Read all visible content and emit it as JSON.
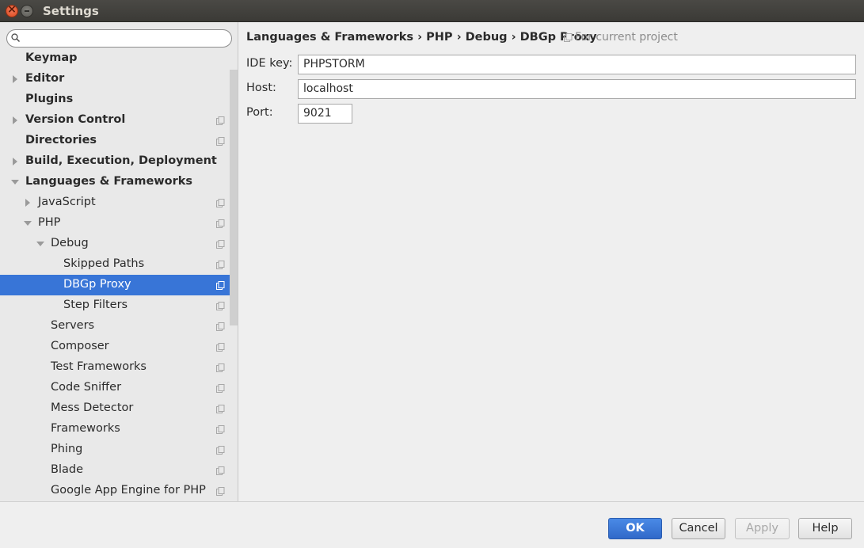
{
  "window": {
    "title": "Settings"
  },
  "search": {
    "placeholder": ""
  },
  "tree": [
    {
      "label": "Keymap",
      "bold": true,
      "arrow": "none",
      "shared": false
    },
    {
      "label": "Editor",
      "bold": true,
      "arrow": "right",
      "shared": false
    },
    {
      "label": "Plugins",
      "bold": true,
      "arrow": "none",
      "shared": false
    },
    {
      "label": "Version Control",
      "bold": true,
      "arrow": "right",
      "shared": true
    },
    {
      "label": "Directories",
      "bold": true,
      "arrow": "none",
      "shared": true
    },
    {
      "label": "Build, Execution, Deployment",
      "bold": true,
      "arrow": "right",
      "shared": false
    },
    {
      "label": "Languages & Frameworks",
      "bold": true,
      "arrow": "down",
      "shared": false
    },
    {
      "label": "JavaScript",
      "bold": false,
      "arrow": "right",
      "shared": true
    },
    {
      "label": "PHP",
      "bold": false,
      "arrow": "down",
      "shared": true
    },
    {
      "label": "Debug",
      "bold": false,
      "arrow": "down",
      "shared": true
    },
    {
      "label": "Skipped Paths",
      "bold": false,
      "arrow": "none",
      "shared": true
    },
    {
      "label": "DBGp Proxy",
      "bold": false,
      "arrow": "none",
      "shared": true,
      "selected": true
    },
    {
      "label": "Step Filters",
      "bold": false,
      "arrow": "none",
      "shared": true
    },
    {
      "label": "Servers",
      "bold": false,
      "arrow": "none",
      "shared": true
    },
    {
      "label": "Composer",
      "bold": false,
      "arrow": "none",
      "shared": true
    },
    {
      "label": "Test Frameworks",
      "bold": false,
      "arrow": "none",
      "shared": true
    },
    {
      "label": "Code Sniffer",
      "bold": false,
      "arrow": "none",
      "shared": true
    },
    {
      "label": "Mess Detector",
      "bold": false,
      "arrow": "none",
      "shared": true
    },
    {
      "label": "Frameworks",
      "bold": false,
      "arrow": "none",
      "shared": true
    },
    {
      "label": "Phing",
      "bold": false,
      "arrow": "none",
      "shared": true
    },
    {
      "label": "Blade",
      "bold": false,
      "arrow": "none",
      "shared": true
    },
    {
      "label": "Google App Engine for PHP",
      "bold": false,
      "arrow": "none",
      "shared": true
    }
  ],
  "breadcrumb": "Languages & Frameworks › PHP › Debug › DBGp Proxy",
  "scope_note": "For current project",
  "form": {
    "ide_key_label": "IDE key:",
    "ide_key_value": "PHPSTORM",
    "host_label": "Host:",
    "host_value": "localhost",
    "port_label": "Port:",
    "port_value": "9021"
  },
  "buttons": {
    "ok": "OK",
    "cancel": "Cancel",
    "apply": "Apply",
    "help": "Help"
  },
  "colors": {
    "selection": "#3875d7",
    "primary_button": "#3a78d8",
    "title_bar": "#3c3b37"
  }
}
